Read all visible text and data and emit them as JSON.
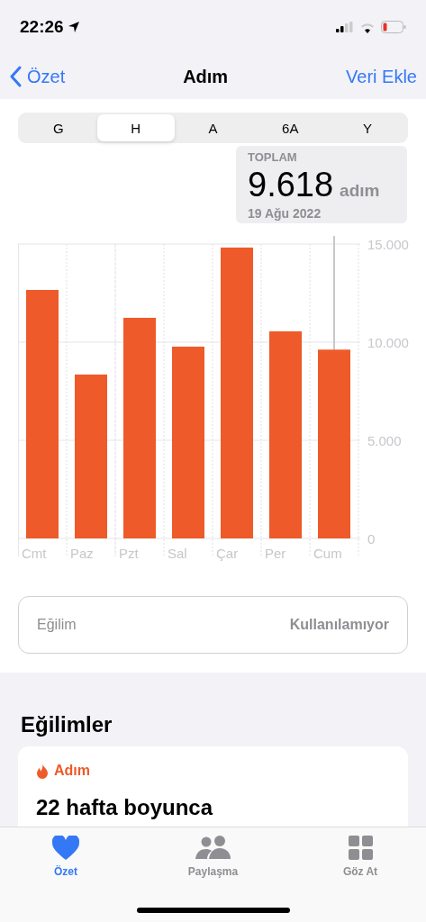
{
  "status_bar": {
    "time": "22:26"
  },
  "nav": {
    "back": "Özet",
    "title": "Adım",
    "action": "Veri Ekle"
  },
  "segments": [
    {
      "label": "G",
      "selected": false
    },
    {
      "label": "H",
      "selected": true
    },
    {
      "label": "A",
      "selected": false
    },
    {
      "label": "6A",
      "selected": false
    },
    {
      "label": "Y",
      "selected": false
    }
  ],
  "tooltip": {
    "title": "TOPLAM",
    "value": "9.618",
    "unit": "adım",
    "date": "19 Ağu 2022"
  },
  "chart": {
    "chart_data": {
      "type": "bar",
      "categories": [
        "Cmt",
        "Paz",
        "Pzt",
        "Sal",
        "Çar",
        "Per",
        "Cum"
      ],
      "series": [
        {
          "color": "#ee5a2a",
          "values": [
            12660,
            8350,
            11240,
            9770,
            14820,
            10550,
            9620
          ]
        }
      ],
      "ylim": [
        0,
        15000
      ],
      "yticks": [
        {
          "value": 0,
          "label": "0"
        },
        {
          "value": 5000,
          "label": "5.000"
        },
        {
          "value": 10000,
          "label": "10.000"
        },
        {
          "value": 15000,
          "label": "15.000"
        }
      ]
    }
  },
  "trend_row": {
    "label": "Eğilim",
    "value": "Kullanılamıyor"
  },
  "trends": {
    "heading": "Eğilimler",
    "card_title": "Adım",
    "card_text": "22 hafta boyunca"
  },
  "tab_bar": [
    {
      "label": "Özet",
      "selected": true
    },
    {
      "label": "Paylaşma",
      "selected": false
    },
    {
      "label": "Göz At",
      "selected": false
    }
  ]
}
